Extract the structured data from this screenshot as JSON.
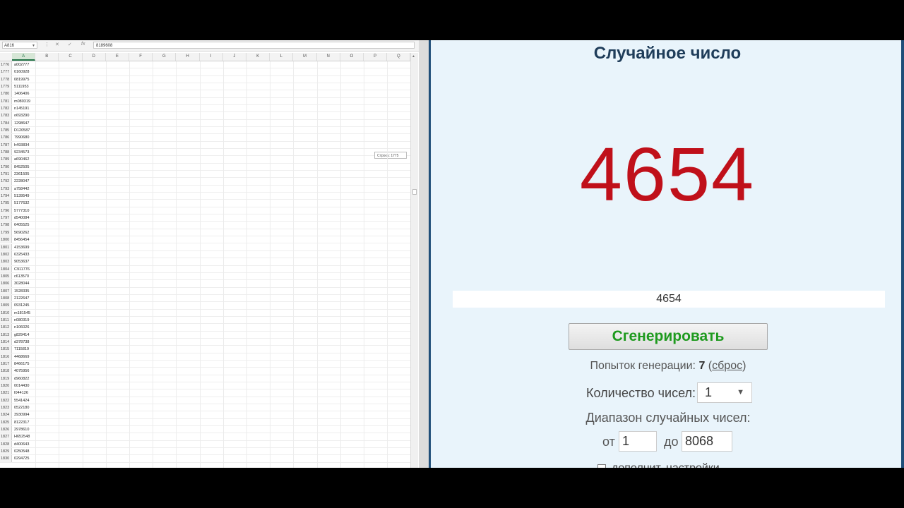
{
  "excel": {
    "name_box": "A816",
    "formula_value": "8189608",
    "columns": [
      "A",
      "B",
      "C",
      "D",
      "E",
      "F",
      "G",
      "H",
      "I",
      "J",
      "K",
      "L",
      "M",
      "N",
      "O",
      "P",
      "Q"
    ],
    "tooltip": "Строка: 1775",
    "rows": [
      {
        "n": "1776",
        "v": "a002777"
      },
      {
        "n": "1777",
        "v": "0160928"
      },
      {
        "n": "1778",
        "v": "0819975"
      },
      {
        "n": "1779",
        "v": "5111953"
      },
      {
        "n": "1780",
        "v": "1406406"
      },
      {
        "n": "1781",
        "v": "m080319"
      },
      {
        "n": "1782",
        "v": "n145191"
      },
      {
        "n": "1783",
        "v": "o693290"
      },
      {
        "n": "1784",
        "v": "1298647"
      },
      {
        "n": "1785",
        "v": "D120587"
      },
      {
        "n": "1786",
        "v": "7990680"
      },
      {
        "n": "1787",
        "v": "h493834"
      },
      {
        "n": "1788",
        "v": "9234573"
      },
      {
        "n": "1789",
        "v": "a690462"
      },
      {
        "n": "1790",
        "v": "8452505"
      },
      {
        "n": "1791",
        "v": "2361505"
      },
      {
        "n": "1792",
        "v": "2228047"
      },
      {
        "n": "1793",
        "v": "a758442"
      },
      {
        "n": "1794",
        "v": "5139549"
      },
      {
        "n": "1795",
        "v": "5177632"
      },
      {
        "n": "1796",
        "v": "5777310"
      },
      {
        "n": "1797",
        "v": "d540084"
      },
      {
        "n": "1798",
        "v": "6405525"
      },
      {
        "n": "1799",
        "v": "5690262"
      },
      {
        "n": "1800",
        "v": "8456454"
      },
      {
        "n": "1801",
        "v": "4153699"
      },
      {
        "n": "1802",
        "v": "6325433"
      },
      {
        "n": "1803",
        "v": "9053637"
      },
      {
        "n": "1804",
        "v": "C911776"
      },
      {
        "n": "1805",
        "v": "c613570"
      },
      {
        "n": "1806",
        "v": "3028044"
      },
      {
        "n": "1807",
        "v": "1528335"
      },
      {
        "n": "1808",
        "v": "2122647"
      },
      {
        "n": "1809",
        "v": "0931245"
      },
      {
        "n": "1810",
        "v": "m181545"
      },
      {
        "n": "1811",
        "v": "n080319"
      },
      {
        "n": "1812",
        "v": "n106026"
      },
      {
        "n": "1813",
        "v": "g829414"
      },
      {
        "n": "1814",
        "v": "d378738"
      },
      {
        "n": "1815",
        "v": "7115819"
      },
      {
        "n": "1816",
        "v": "4468669"
      },
      {
        "n": "1817",
        "v": "8466175"
      },
      {
        "n": "1818",
        "v": "4075956"
      },
      {
        "n": "1819",
        "v": "d960822"
      },
      {
        "n": "1820",
        "v": "0014430"
      },
      {
        "n": "1821",
        "v": "I044126"
      },
      {
        "n": "1822",
        "v": "5541424"
      },
      {
        "n": "1823",
        "v": "0522180"
      },
      {
        "n": "1824",
        "v": "3930994"
      },
      {
        "n": "1825",
        "v": "8122317"
      },
      {
        "n": "1826",
        "v": "2978610"
      },
      {
        "n": "1827",
        "v": "H652548"
      },
      {
        "n": "1828",
        "v": "d400643"
      },
      {
        "n": "1829",
        "v": "0250548"
      },
      {
        "n": "1830",
        "v": "0294725"
      }
    ]
  },
  "generator": {
    "title": "Случайное число",
    "big_number": "4654",
    "result_field": "4654",
    "generate_label": "Сгенерировать",
    "attempts_prefix": "Попыток генерации:",
    "attempts_count": "7",
    "attempts_reset": "сброс",
    "count_label": "Количество чисел:",
    "count_value": "1",
    "range_label": "Диапазон случайных чисел:",
    "from_label": "от",
    "from_value": "1",
    "to_label": "до",
    "to_value": "8068",
    "extra_settings": "дополнит. настройки"
  }
}
